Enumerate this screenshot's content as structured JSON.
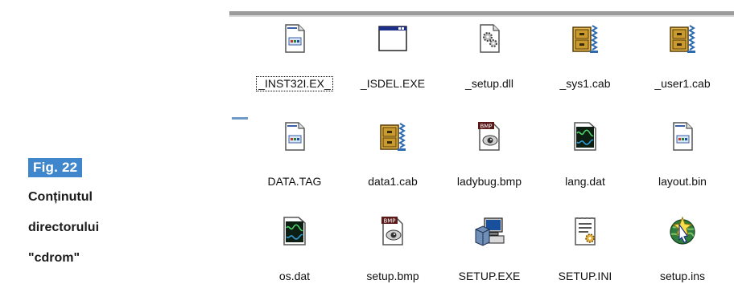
{
  "caption": {
    "badge": "Fig. 22",
    "line1": "Conținutul",
    "line2": "directorului",
    "line3": "\"cdrom\""
  },
  "files": [
    {
      "name": "_INST32I.EX_",
      "icon": "generic-file-icon",
      "selected": true
    },
    {
      "name": "_ISDEL.EXE",
      "icon": "exe-window-icon",
      "selected": false
    },
    {
      "name": "_setup.dll",
      "icon": "dll-gear-icon",
      "selected": false
    },
    {
      "name": "_sys1.cab",
      "icon": "cabinet-archive-icon",
      "selected": false
    },
    {
      "name": "_user1.cab",
      "icon": "cabinet-archive-icon",
      "selected": false
    },
    {
      "name": "DATA.TAG",
      "icon": "generic-file-icon",
      "selected": false
    },
    {
      "name": "data1.cab",
      "icon": "cabinet-archive-icon",
      "selected": false
    },
    {
      "name": "ladybug.bmp",
      "icon": "bmp-image-icon",
      "selected": false
    },
    {
      "name": "lang.dat",
      "icon": "dat-waveform-icon",
      "selected": false
    },
    {
      "name": "layout.bin",
      "icon": "generic-file-icon",
      "selected": false
    },
    {
      "name": "os.dat",
      "icon": "dat-waveform-icon",
      "selected": false
    },
    {
      "name": "setup.bmp",
      "icon": "bmp-image-icon",
      "selected": false
    },
    {
      "name": "SETUP.EXE",
      "icon": "setup-computer-icon",
      "selected": false
    },
    {
      "name": "SETUP.INI",
      "icon": "ini-config-icon",
      "selected": false
    },
    {
      "name": "setup.ins",
      "icon": "setup-globe-icon",
      "selected": false
    }
  ]
}
